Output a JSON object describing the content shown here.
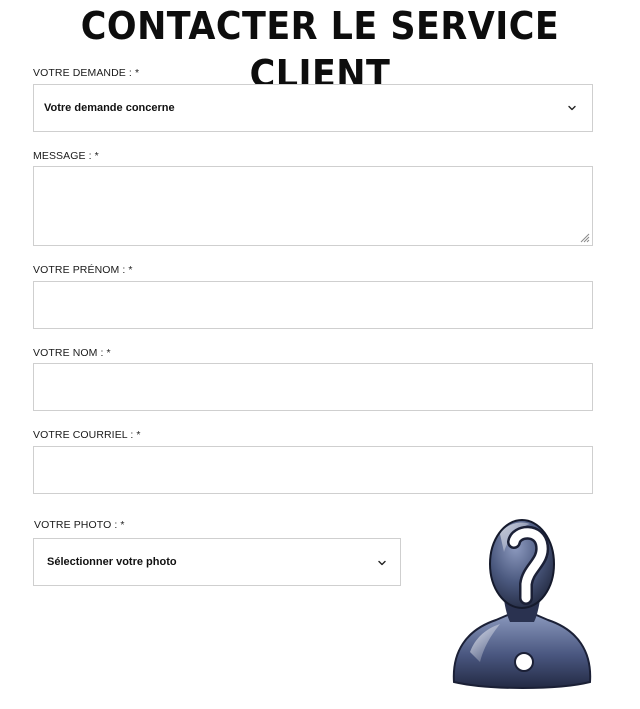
{
  "page": {
    "title": "CONTACTER LE SERVICE CLIENT"
  },
  "form": {
    "demande": {
      "label": "VOTRE DEMANDE : *",
      "selected": "Votre demande concerne"
    },
    "message": {
      "label": "MESSAGE : *",
      "value": ""
    },
    "prenom": {
      "label": "VOTRE PRÉNOM : *",
      "value": ""
    },
    "nom": {
      "label": "VOTRE NOM : *",
      "value": ""
    },
    "courriel": {
      "label": "VOTRE COURRIEL : *",
      "value": ""
    },
    "photo": {
      "label": "VOTRE PHOTO : *",
      "selected": "Sélectionner votre photo"
    }
  },
  "icons": {
    "select_chevron": "chevron-down-icon",
    "resize": "resize-grip-icon",
    "avatar": "unknown-user-question-icon"
  },
  "colors": {
    "border": "#cfcfcf",
    "text": "#111111",
    "avatar_dark": "#2b3550",
    "avatar_light": "#7d8cb0"
  }
}
